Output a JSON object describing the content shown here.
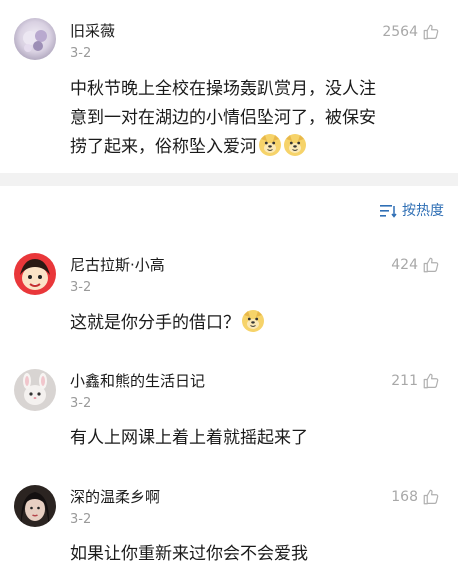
{
  "comments": [
    {
      "user": "旧采薇",
      "date": "3-2",
      "likes": "2564",
      "text_lines": [
        "中秋节晚上全校在操场轰趴赏月，没人注",
        "意到一对在湖边的小情侣坠河了，被保安",
        "捞了起来，俗称坠入爱河"
      ],
      "emoji_count": 2
    },
    {
      "user": "尼古拉斯·小高",
      "date": "3-2",
      "likes": "424",
      "text_lines": [
        "这就是你分手的借口？"
      ],
      "emoji_count": 1
    },
    {
      "user": "小鑫和熊的生活日记",
      "date": "3-2",
      "likes": "211",
      "text_lines": [
        "有人上网课上着上着就摇起来了"
      ],
      "emoji_count": 0
    },
    {
      "user": "深的温柔乡啊",
      "date": "3-2",
      "likes": "168",
      "text_lines": [
        "如果让你重新来过你会不会爱我"
      ],
      "emoji_count": 0
    }
  ],
  "sort": {
    "label": "按热度",
    "icon": "sort-lines-icon"
  },
  "colors": {
    "accent": "#2f6fb5",
    "muted": "#9a9a9a",
    "divider": "#f2f2f2"
  }
}
